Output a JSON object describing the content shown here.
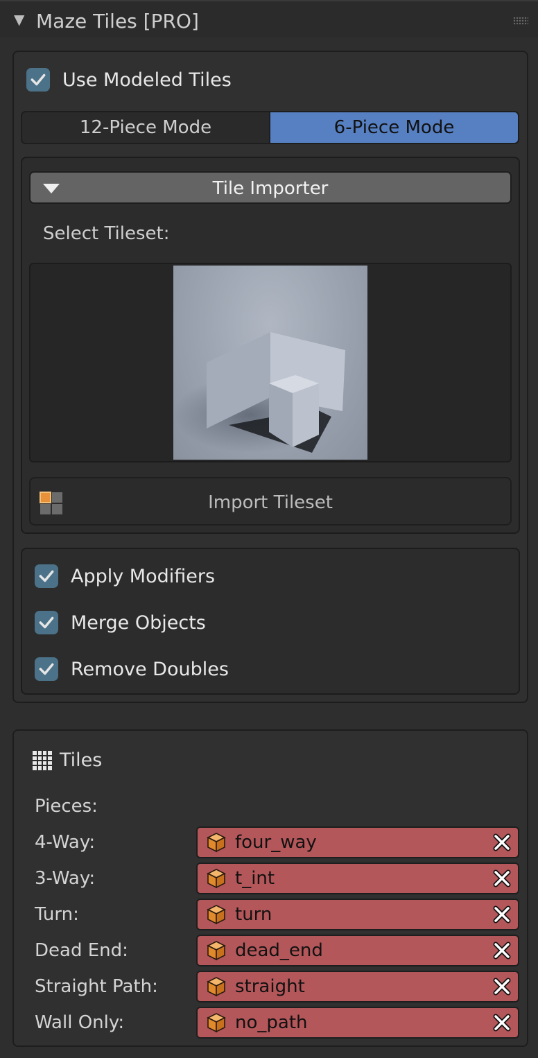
{
  "panel": {
    "title": "Maze Tiles [PRO]"
  },
  "modeled": {
    "label": "Use Modeled Tiles",
    "checked": true
  },
  "modes": {
    "option_12": "12-Piece Mode",
    "option_6": "6-Piece Mode",
    "selected": "6-Piece Mode"
  },
  "importer": {
    "title": "Tile Importer",
    "select_label": "Select Tileset:",
    "import_button": "Import Tileset"
  },
  "options": [
    {
      "label": "Apply Modifiers",
      "checked": true
    },
    {
      "label": "Merge Objects",
      "checked": true
    },
    {
      "label": "Remove Doubles",
      "checked": true
    }
  ],
  "tiles": {
    "title": "Tiles",
    "pieces_label": "Pieces:",
    "rows": [
      {
        "label": "4-Way:",
        "value": "four_way"
      },
      {
        "label": "3-Way:",
        "value": "t_int"
      },
      {
        "label": "Turn:",
        "value": "turn"
      },
      {
        "label": "Dead End:",
        "value": "dead_end"
      },
      {
        "label": "Straight Path:",
        "value": "straight"
      },
      {
        "label": "Wall Only:",
        "value": "no_path"
      }
    ]
  },
  "colors": {
    "accent": "#5680c2",
    "checkbox": "#4b7288",
    "object_field": "#b4575a"
  }
}
